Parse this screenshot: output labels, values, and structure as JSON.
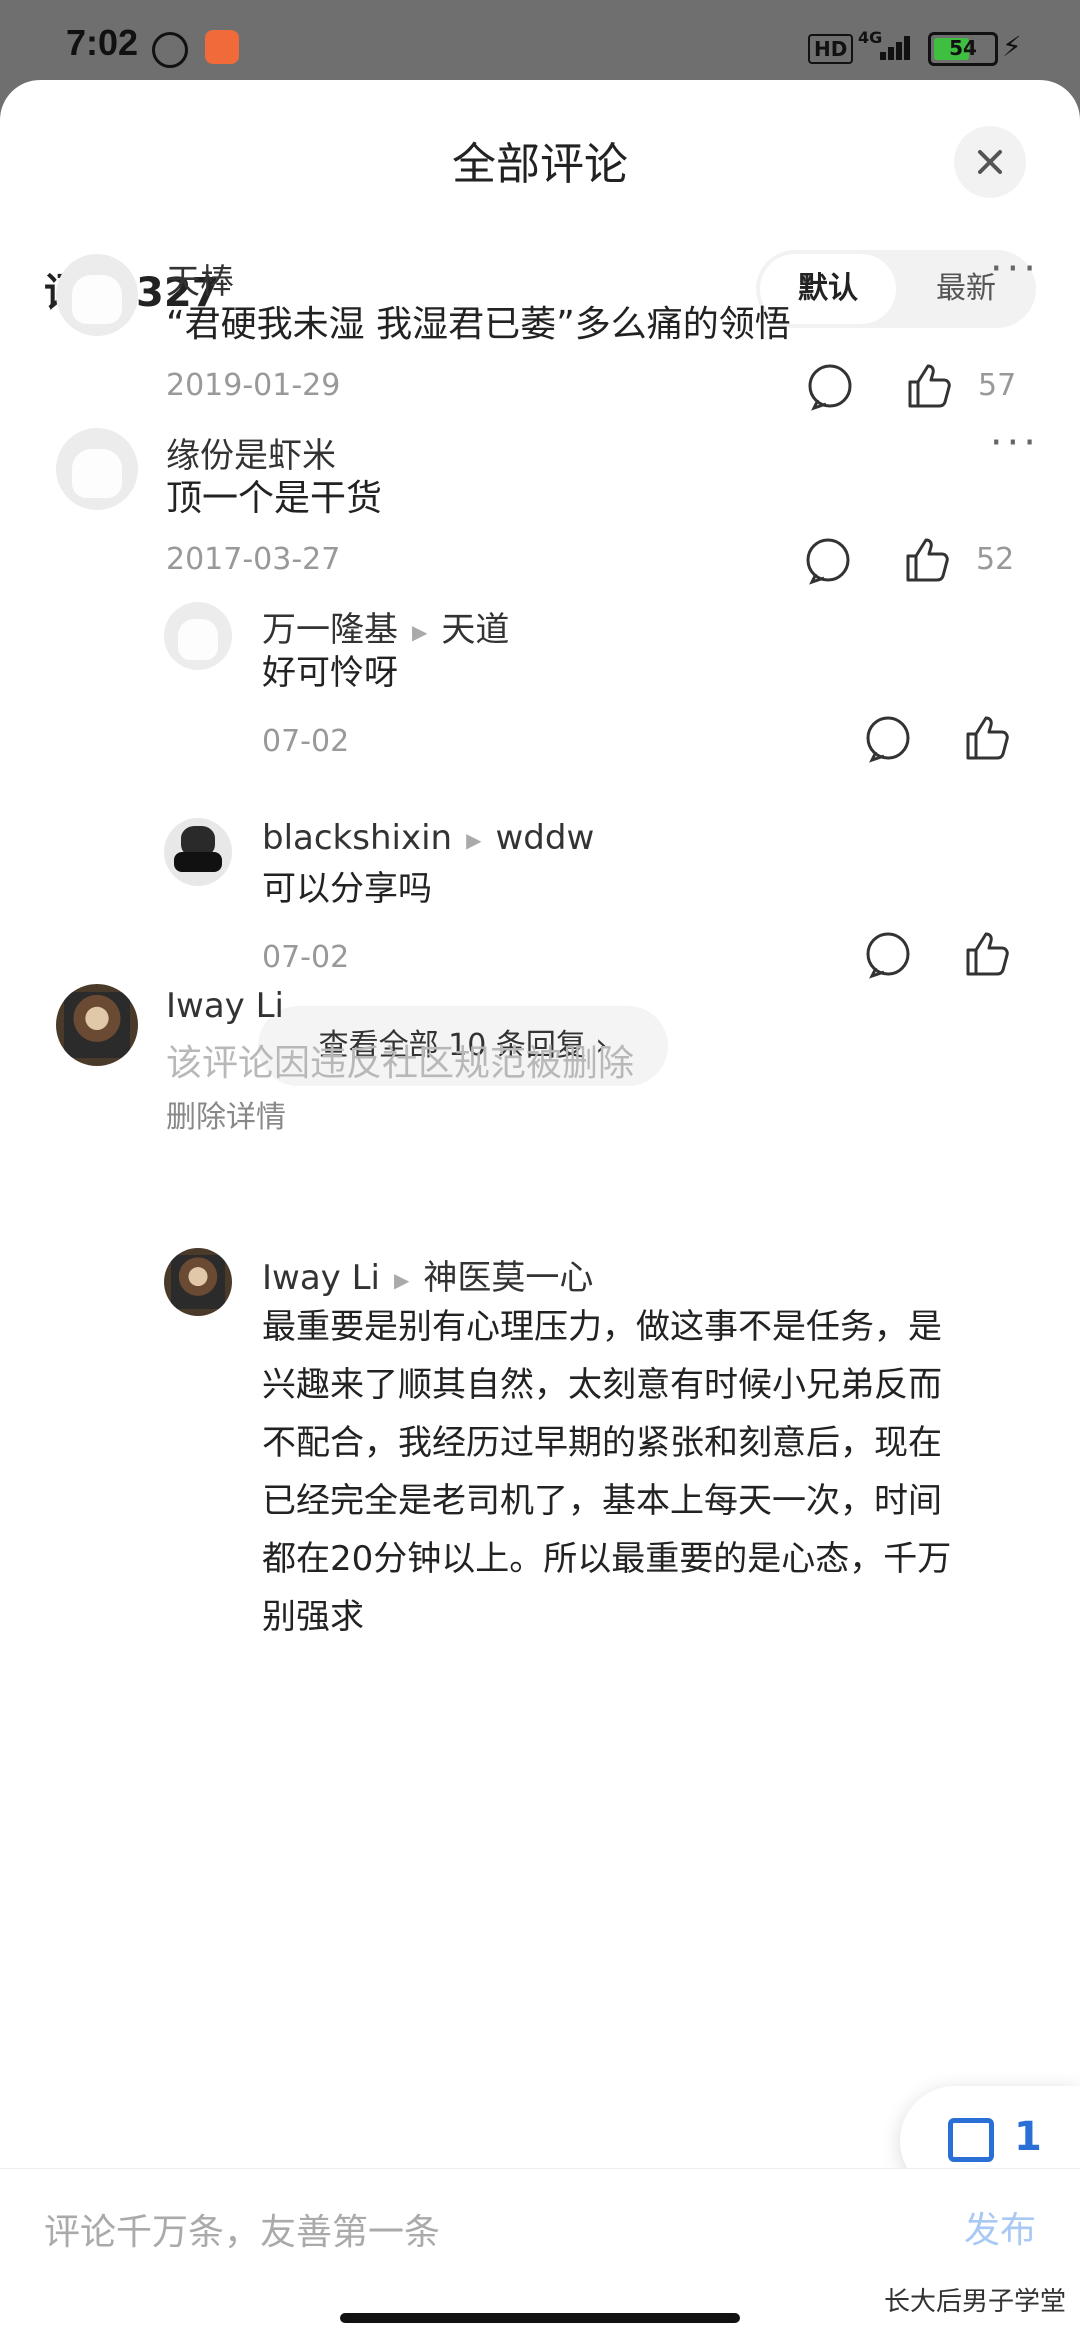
{
  "status_bar": {
    "time": "7:02",
    "network": "4G",
    "hd": "HD",
    "battery": "54"
  },
  "sheet": {
    "title": "全部评论",
    "comment_count_label": "评论",
    "comment_count": "327",
    "sort_options": [
      "默认",
      "最新"
    ],
    "active_sort": "默认"
  },
  "comments": [
    {
      "author": "天棒",
      "text": "“君硬我未湿 我湿君已萎”多么痛的领悟",
      "date": "2019-01-29",
      "likes": "57"
    },
    {
      "author": "缘份是虾米",
      "text": "顶一个是干货",
      "date": "2017-03-27",
      "likes": "52",
      "replies": [
        {
          "author": "万一隆基",
          "reply_to": "天道",
          "text": "好可怜呀",
          "date": "07-02"
        },
        {
          "author": "blackshixin",
          "reply_to": "wddw",
          "text": "可以分享吗",
          "date": "07-02"
        }
      ],
      "view_all": "查看全部 10 条回复 ›"
    },
    {
      "author": "Iway Li",
      "deleted_text": "该评论因违反社区规范被删除",
      "deleted_detail": "删除详情",
      "replies": [
        {
          "author": "Iway Li",
          "reply_to": "神医莫一心",
          "lines": [
            "最重要是别有心理压力，做这事不是任务，是",
            "兴趣来了顺其自然，太刻意有时候小兄弟反而",
            "不配合，我经历过早期的紧张和刻意后，现在",
            "已经完全是老司机了，基本上每天一次，时间",
            "都在20分钟以上。所以最重要的是心态，千万",
            "别强求"
          ]
        }
      ]
    }
  ],
  "floating_badge": "1",
  "bottom": {
    "placeholder": "评论千万条，友善第一条",
    "publish": "发布",
    "watermark": "长大后男子学堂"
  },
  "colors": {
    "accent": "#2a6fd6",
    "publish_disabled": "#a9c9f5",
    "muted": "#999999"
  }
}
